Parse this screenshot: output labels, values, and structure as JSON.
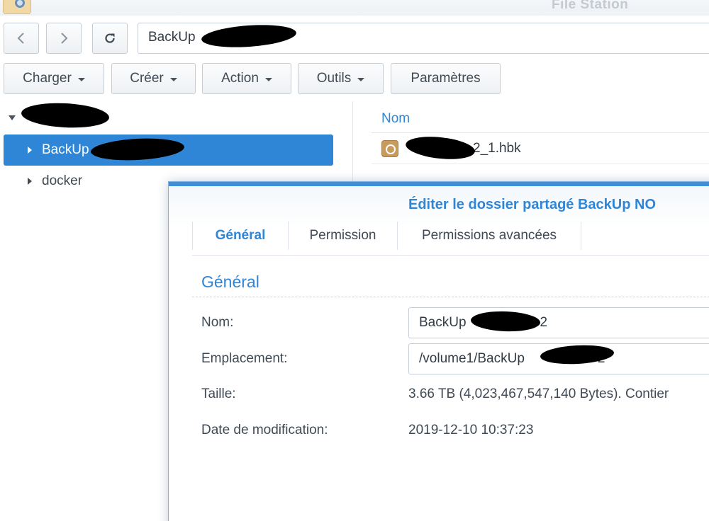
{
  "app": {
    "title": "File Station",
    "icon": "file-station-icon"
  },
  "toolbar": {
    "back_icon": "chevron-left-icon",
    "forward_icon": "chevron-right-icon",
    "refresh_icon": "refresh-icon",
    "path": "BackUp",
    "buttons": {
      "upload": "Charger",
      "create": "Créer",
      "action": "Action",
      "tools": "Outils",
      "settings": "Paramètres"
    }
  },
  "tree": {
    "items": [
      {
        "label": "BackUp"
      },
      {
        "label": "docker"
      }
    ]
  },
  "file_list": {
    "columns": [
      "Nom"
    ],
    "rows": [
      {
        "name": "2_1.hbk",
        "icon": "backup-file-icon"
      }
    ]
  },
  "dialog": {
    "title": "Éditer le dossier partagé BackUp NO",
    "tabs": [
      "Général",
      "Permission",
      "Permissions avancées"
    ],
    "section_title": "Général",
    "fields": {
      "name_label": "Nom:",
      "name_value": "BackUp",
      "name_suffix": "2",
      "location_label": "Emplacement:",
      "location_value": "/volume1/BackUp",
      "location_suffix": "2",
      "size_label": "Taille:",
      "size_value": "3.66 TB (4,023,467,547,140 Bytes). Contier",
      "modified_label": "Date de modification:",
      "modified_value": "2019-12-10 10:37:23"
    }
  },
  "colors": {
    "accent": "#2f86d7",
    "selected_bg": "#2f86d7",
    "text": "#404a55",
    "border": "#c6ccd4"
  }
}
